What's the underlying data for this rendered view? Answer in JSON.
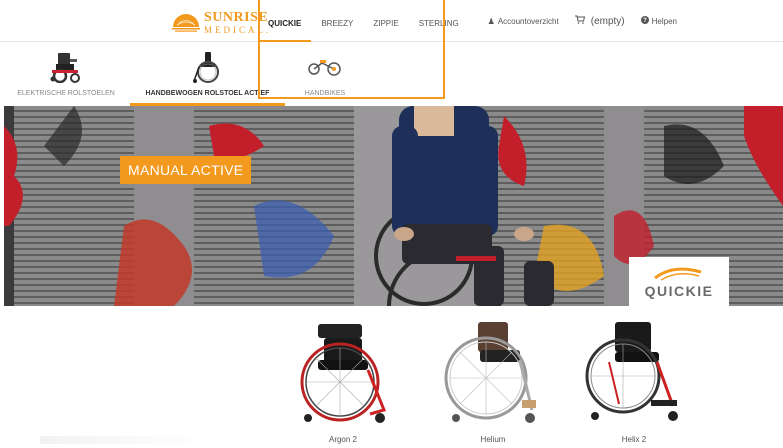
{
  "header": {
    "logo": {
      "name": "SUNRISE",
      "sub": "MEDICAL."
    },
    "brand_tabs": [
      {
        "label": "QUICKIE",
        "active": true
      },
      {
        "label": "BREEZY",
        "active": false
      },
      {
        "label": "ZIPPIE",
        "active": false
      },
      {
        "label": "STERLING",
        "active": false
      }
    ],
    "account": {
      "overview_icon": "user-icon",
      "overview_label": "Accountoverzicht",
      "cart_icon": "cart-icon",
      "cart_label": "(empty)",
      "help_icon": "question-circle-icon",
      "help_label": "Helpen"
    }
  },
  "categories": [
    {
      "label": "ELEKTRISCHE ROLSTOELEN",
      "icon": "power-wheelchair-image",
      "active": false
    },
    {
      "label": "HANDBEWOGEN ROLSTOEL ACTIEF",
      "icon": "manual-wheelchair-image",
      "active": true
    },
    {
      "label": "HANDBIKES",
      "icon": "handbike-image",
      "active": false
    }
  ],
  "hero": {
    "tag": "MANUAL ACTIVE",
    "brand_badge": "QUICKIE"
  },
  "products": [
    {
      "name": "Argon 2"
    },
    {
      "name": "Helium"
    },
    {
      "name": "Helix 2"
    }
  ],
  "colors": {
    "accent": "#f39a1e",
    "text": "#555555"
  }
}
